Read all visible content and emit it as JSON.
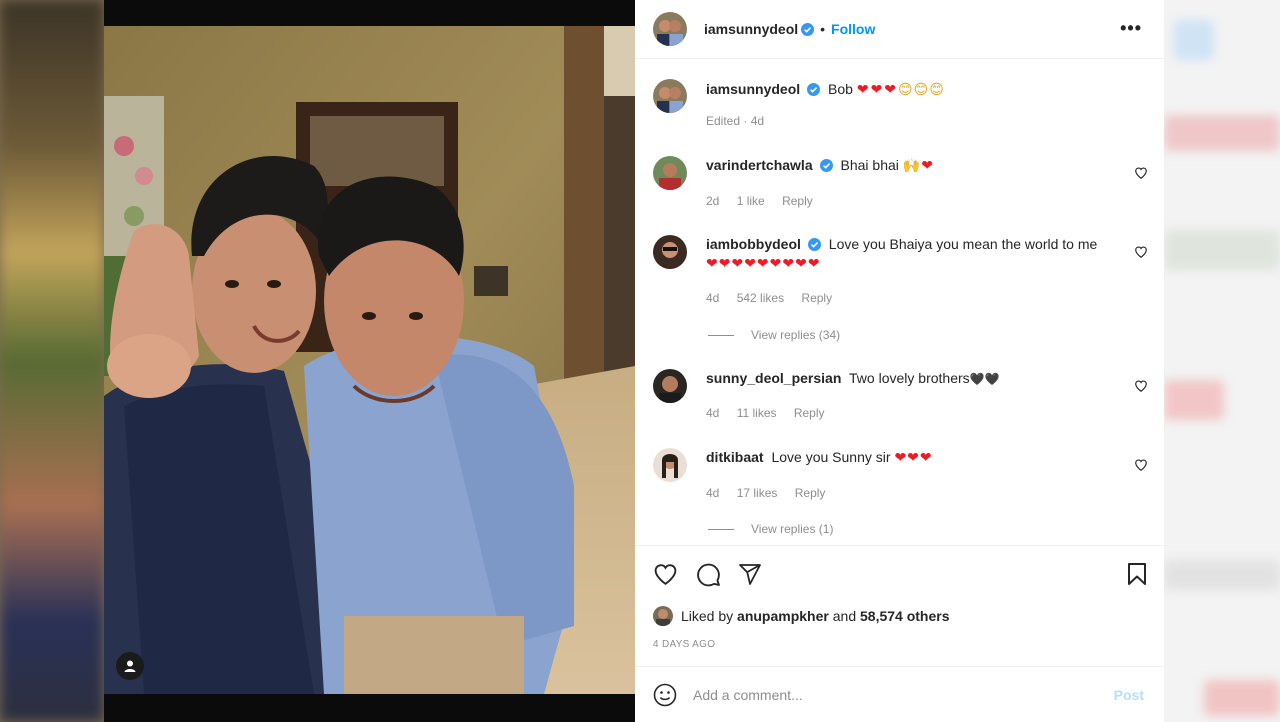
{
  "post": {
    "username": "iamsunnydeol",
    "follow_label": "Follow",
    "dot": "•",
    "more_label": "•••"
  },
  "caption": {
    "username": "iamsunnydeol",
    "text": "Bob",
    "emoji_hearts": "❤❤❤",
    "emoji_smiles": "😊😊😊",
    "meta": "Edited · 4d"
  },
  "comments": [
    {
      "username": "varindertchawla",
      "verified": true,
      "text": "Bhai bhai",
      "emoji": "🙌❤",
      "age": "2d",
      "likes": "1 like",
      "reply": "Reply"
    },
    {
      "username": "iambobbydeol",
      "verified": true,
      "text": "Love you Bhaiya you mean the world to me",
      "emoji": "❤❤❤❤❤❤❤❤❤",
      "age": "4d",
      "likes": "542 likes",
      "reply": "Reply",
      "view_replies": "View replies (34)"
    },
    {
      "username": "sunny_deol_persian",
      "verified": false,
      "text": "Two lovely brothers",
      "emoji": "🖤🖤",
      "age": "4d",
      "likes": "11 likes",
      "reply": "Reply"
    },
    {
      "username": "ditkibaat",
      "verified": false,
      "text": "Love you Sunny sir",
      "emoji": "❤❤❤",
      "age": "4d",
      "likes": "17 likes",
      "reply": "Reply",
      "view_replies": "View replies (1)"
    }
  ],
  "actions": {
    "like_icon": "heart-icon",
    "comment_icon": "comment-icon",
    "share_icon": "share-icon",
    "save_icon": "bookmark-icon"
  },
  "likes": {
    "prefix": "Liked by",
    "user": "anupampkher",
    "joiner": "and",
    "others": "58,574 others"
  },
  "timestamp": "4 DAYS AGO",
  "comment_box": {
    "placeholder": "Add a comment...",
    "post_label": "Post",
    "emoji_icon": "smiley-icon"
  },
  "colors": {
    "accent": "#0095f6",
    "verified": "#3897f0",
    "heart": "#ed1c24",
    "muted": "#8e8e8e"
  }
}
